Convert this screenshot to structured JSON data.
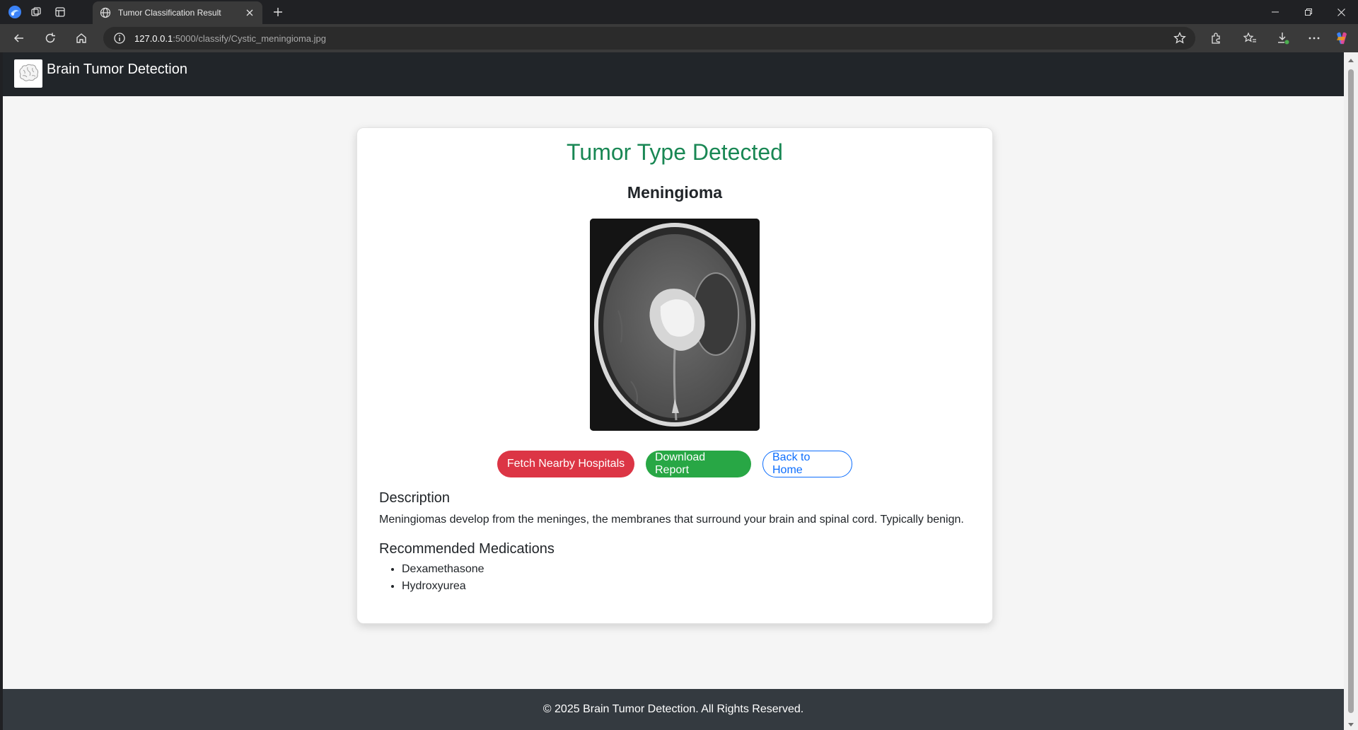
{
  "browser": {
    "tab_title": "Tumor Classification Result",
    "url_host": "127.0.0.1",
    "url_path": ":5000/classify/Cystic_meningioma.jpg",
    "icons": [
      "edge-profile-icon",
      "workspaces-icon",
      "tab-actions-icon",
      "globe-icon",
      "close-tab-icon",
      "new-tab-icon",
      "minimize-icon",
      "restore-icon",
      "close-window-icon",
      "back-icon",
      "refresh-icon",
      "home-icon",
      "site-info-icon",
      "favorite-star-icon",
      "extensions-icon",
      "favorites-icon",
      "downloads-icon",
      "more-icon",
      "copilot-icon"
    ]
  },
  "navbar": {
    "brand": "Brain Tumor Detection",
    "logo_icon": "brain-logo-icon"
  },
  "result": {
    "title": "Tumor Type Detected",
    "tumor_type": "Meningioma",
    "image_icon": "mri-scan-image"
  },
  "buttons": {
    "hospitals": "Fetch Nearby Hospitals",
    "download": "Download Report",
    "home": "Back to Home"
  },
  "description": {
    "heading": "Description",
    "text": "Meningiomas develop from the meninges, the membranes that surround your brain and spinal cord. Typically benign."
  },
  "medications": {
    "heading": "Recommended Medications",
    "items": [
      "Dexamethasone",
      "Hydroxyurea"
    ]
  },
  "footer": {
    "text": "© 2025 Brain Tumor Detection. All Rights Reserved."
  },
  "colors": {
    "title_green": "#198754",
    "danger": "#dc3545",
    "success": "#28a745",
    "primary": "#0d6efd",
    "navbar": "#212529",
    "footer": "#343a40"
  }
}
